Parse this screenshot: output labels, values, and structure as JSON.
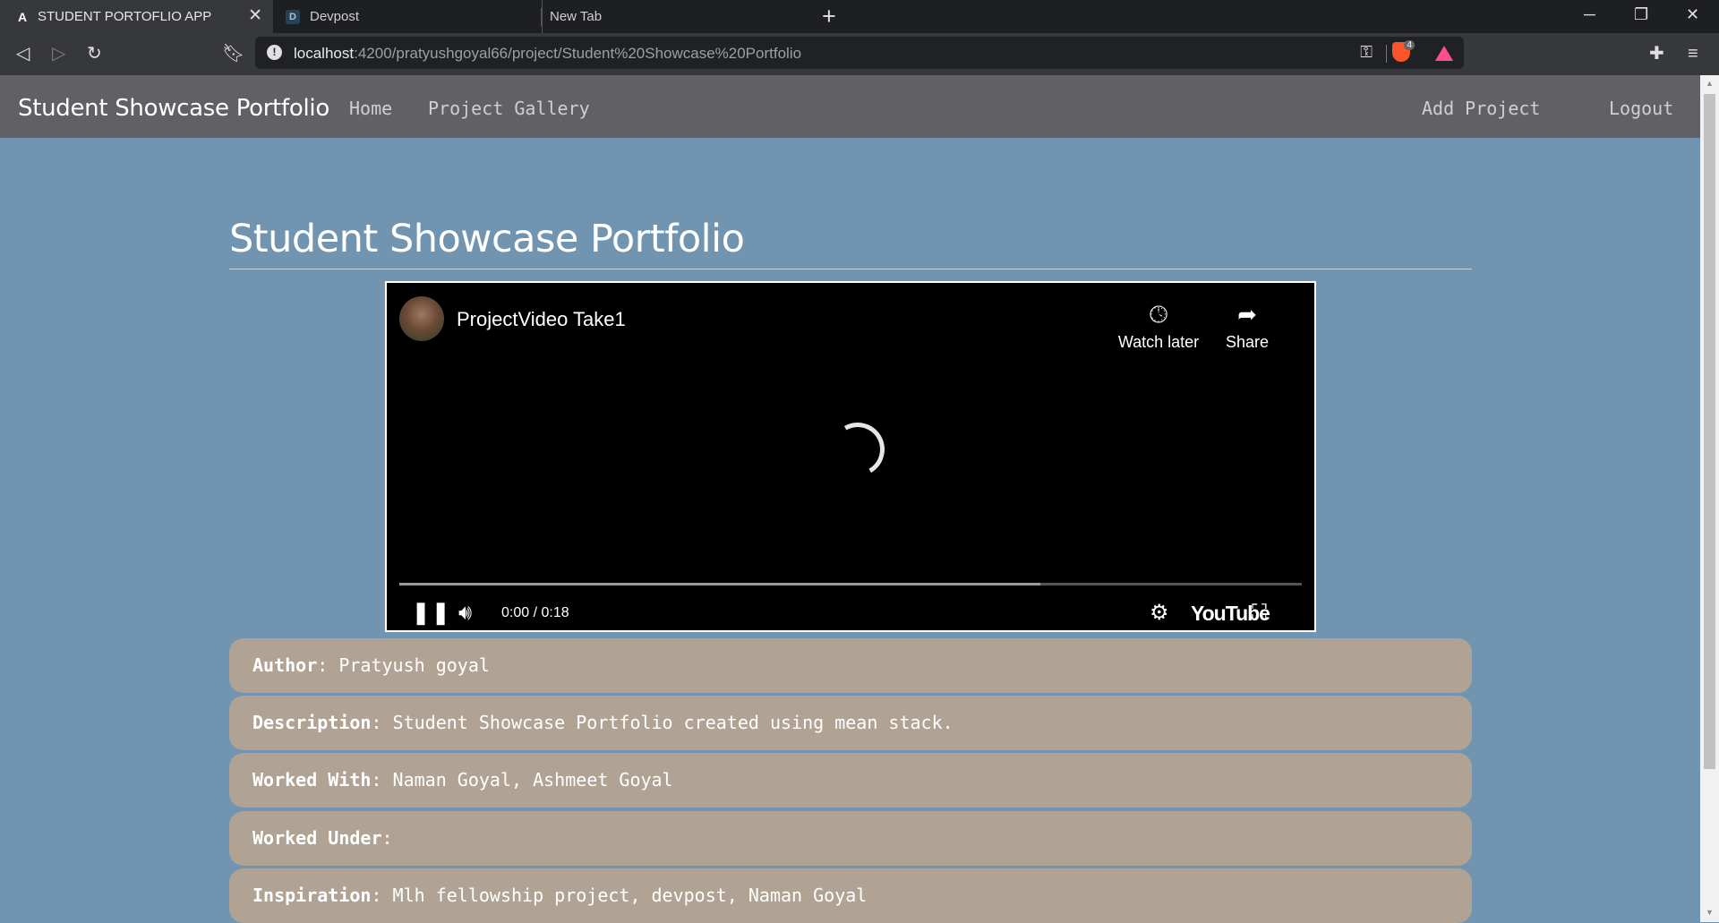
{
  "browser": {
    "tabs": [
      {
        "title": "STUDENT PORTOFLIO APP",
        "active": true,
        "icon": "angular-icon"
      },
      {
        "title": "Devpost",
        "active": false,
        "icon": "devpost-icon"
      },
      {
        "title": "New Tab",
        "active": false
      }
    ],
    "url_host": "localhost",
    "url_path": ":4200/pratyushgoyal66/project/Student%20Showcase%20Portfolio",
    "brave_shield_count": "4"
  },
  "navbar": {
    "brand": "Student Showcase Portfolio",
    "home": "Home",
    "gallery": "Project Gallery",
    "add_project": "Add Project",
    "logout": "Logout",
    "background": "#616064"
  },
  "page": {
    "title": "Student Showcase Portfolio",
    "background": "#7195b0"
  },
  "video": {
    "title": "ProjectVideo Take1",
    "watch_later": "Watch later",
    "share": "Share",
    "time": "0:00 / 0:18",
    "logo": "YouTube",
    "buffered_fraction": 0.71,
    "state": "loading"
  },
  "details": {
    "card_color": "#b1a394",
    "author_label": "Author",
    "author_value": ": Pratyush goyal",
    "description_label": "Description",
    "description_value": ": Student Showcase Portfolio created using mean stack.",
    "worked_with_label": "Worked With",
    "worked_with_value": ": Naman Goyal, Ashmeet Goyal",
    "worked_under_label": "Worked Under",
    "worked_under_value": ":",
    "inspiration_label": "Inspiration",
    "inspiration_value": ": Mlh fellowship project, devpost, Naman Goyal"
  }
}
